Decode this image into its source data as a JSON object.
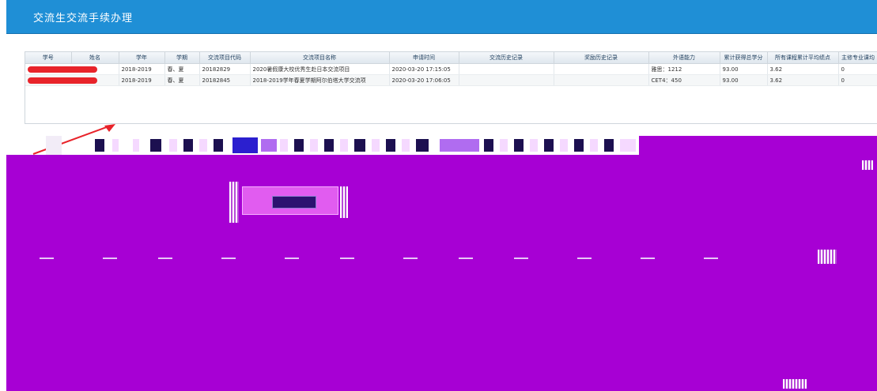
{
  "app": {
    "title": "交流生交流手续办理"
  },
  "grid": {
    "columns": [
      "学号",
      "姓名",
      "学年",
      "学期",
      "交流项目代码",
      "交流项目名称",
      "申请时间",
      "交流历史记录",
      "奖励历史记录",
      "外语能力",
      "累计获得总学分",
      "所有课程累计平均绩点",
      "主修专业课均"
    ],
    "rows": [
      {
        "student_id": "",
        "name": "",
        "year": "2018-2019",
        "term": "春、夏",
        "project_code": "20182829",
        "project_name": "2020暑假康大校优秀生赴日本交流项目",
        "apply_time": "2020-03-20 17:15:05",
        "exchange_history": "",
        "award_history": "",
        "language": "雅思：1212",
        "total_credits": "93.00",
        "gpa": "3.62",
        "major_avg": "0"
      },
      {
        "student_id": "",
        "name": "",
        "year": "2018-2019",
        "term": "春、夏",
        "project_code": "20182845",
        "project_name": "2018-2019学年春夏学期阿尔伯塔大学交流项",
        "apply_time": "2020-03-20 17:06:05",
        "exchange_history": "",
        "award_history": "",
        "language": "CET4：450",
        "total_credits": "93.00",
        "gpa": "3.62",
        "major_avg": "0"
      }
    ]
  },
  "colors": {
    "header": "#1f8fd6",
    "redaction": "#e8232a",
    "arrow": "#e8232a",
    "corrupted_area": "#a700d4"
  }
}
